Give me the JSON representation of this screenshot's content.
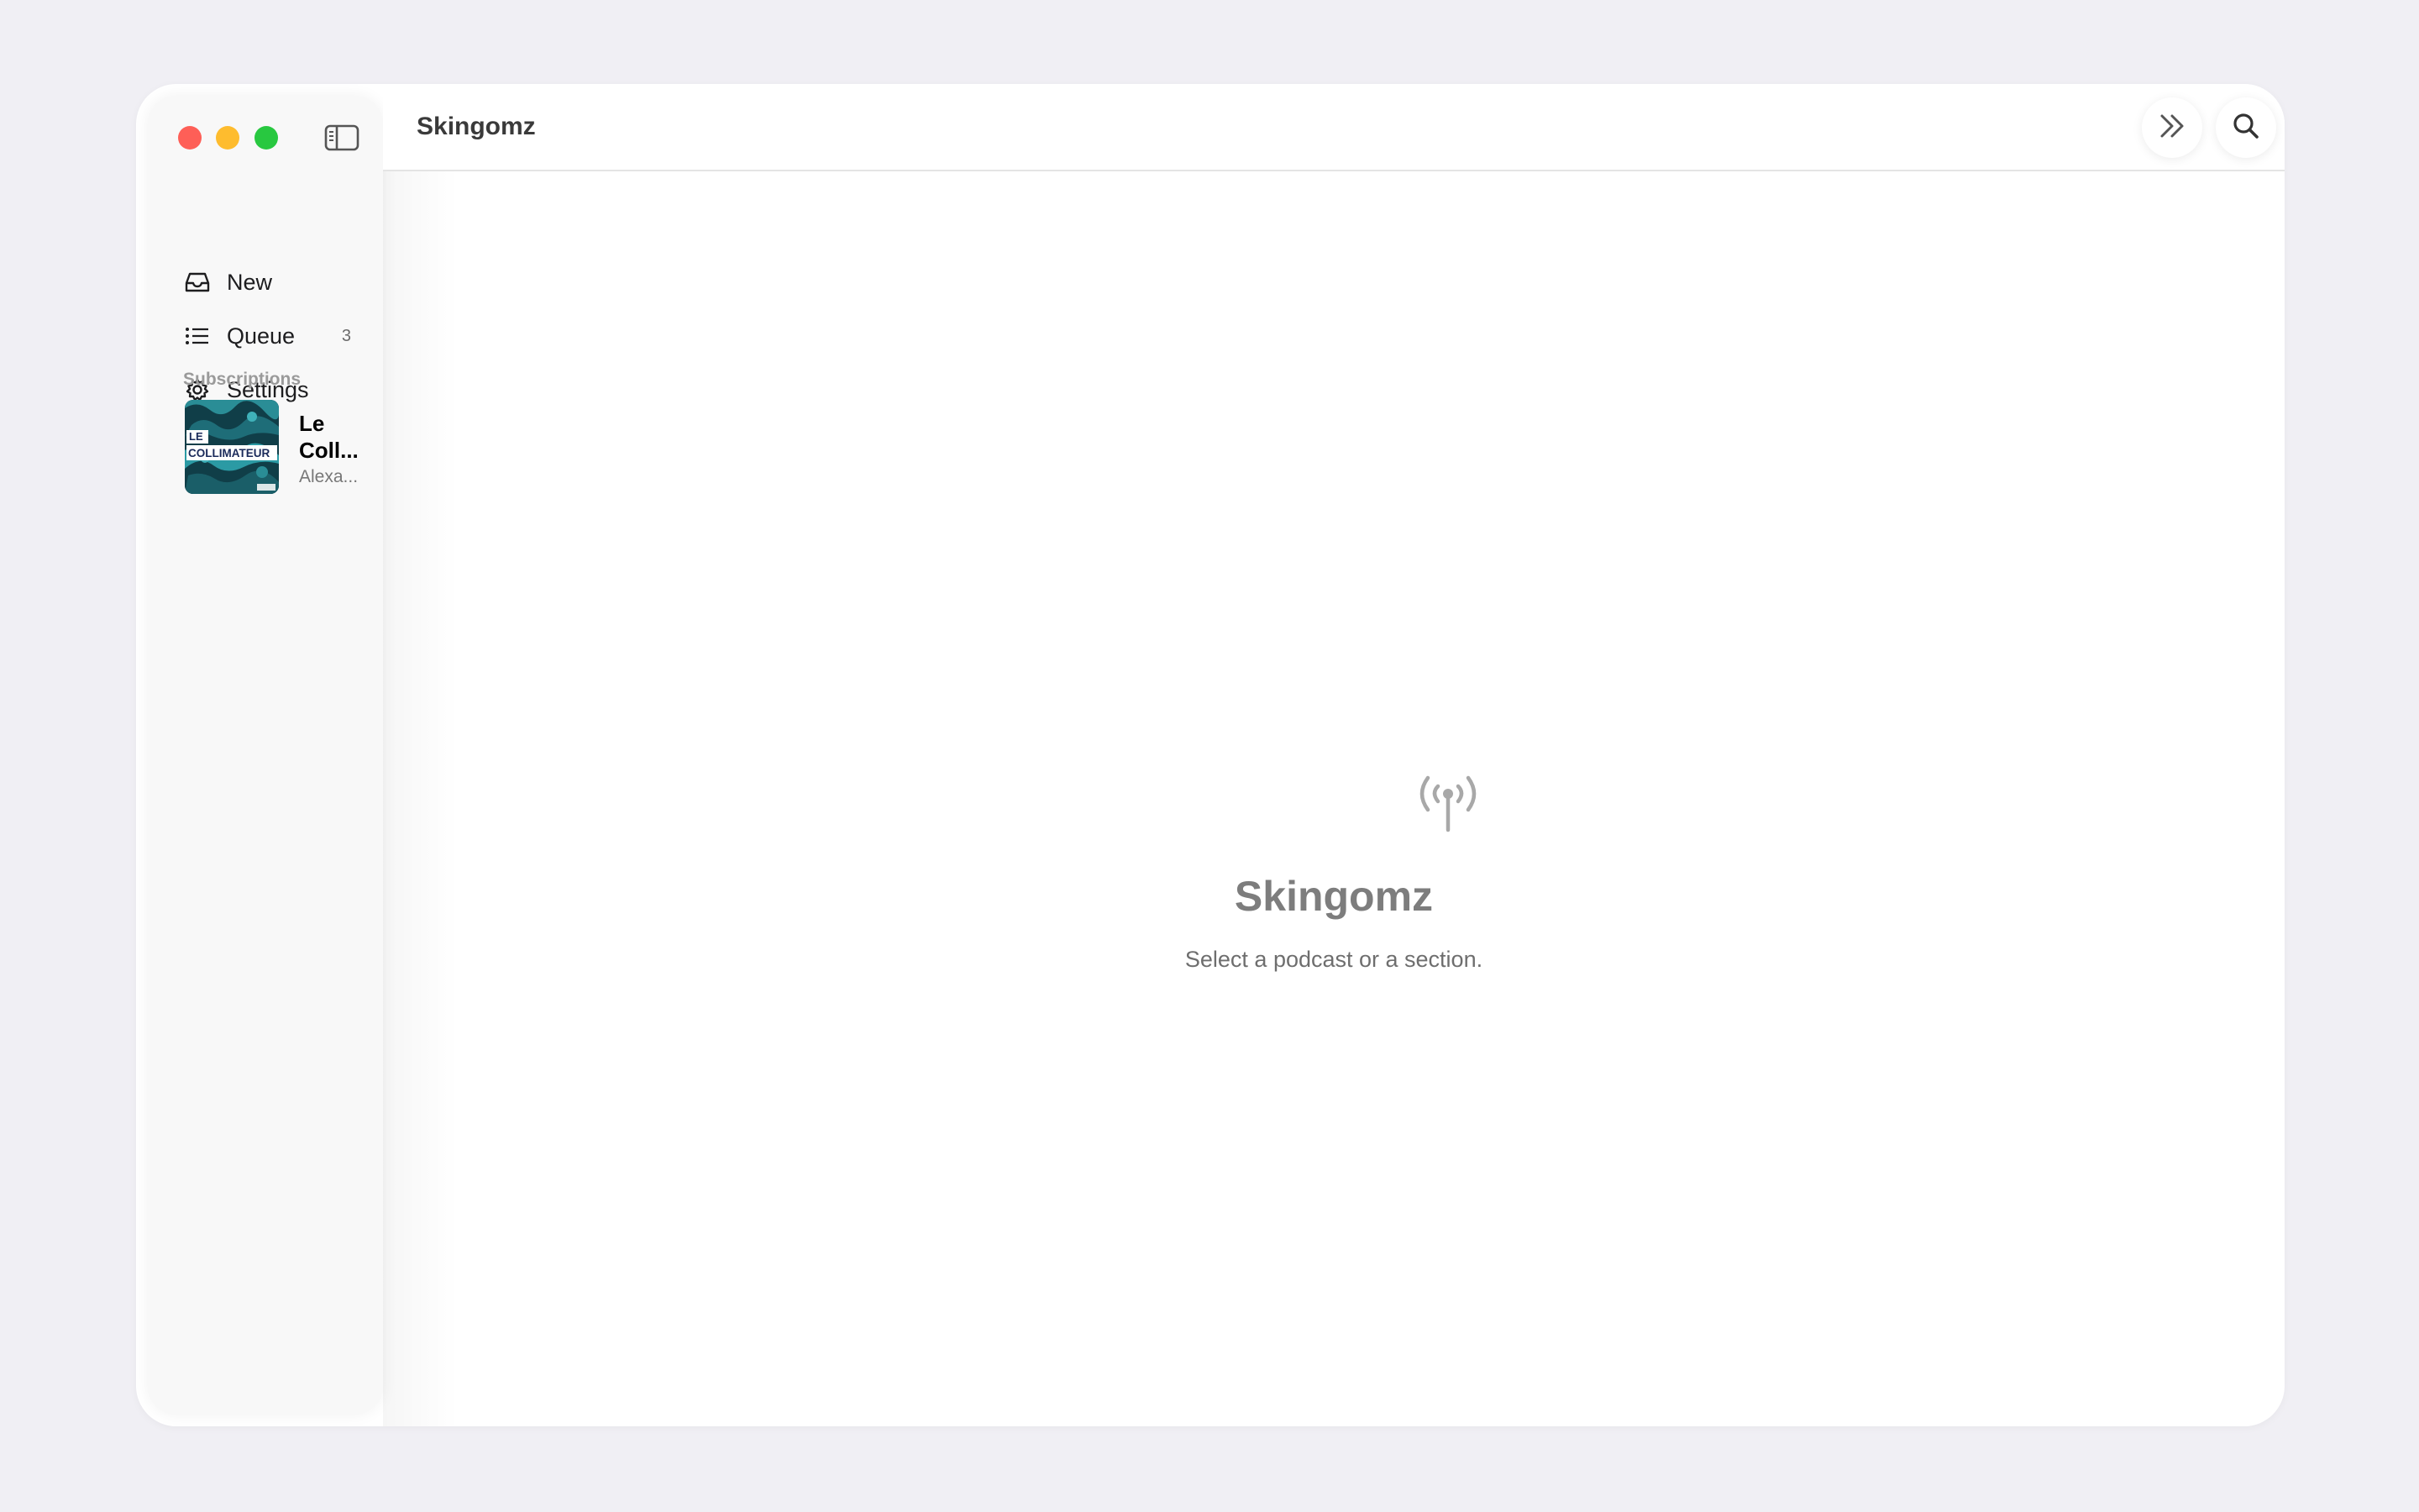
{
  "window": {
    "title": "Skingomz",
    "controls": [
      "close",
      "minimize",
      "zoom"
    ],
    "colors": {
      "close": "#fe5f57",
      "minimize": "#febc2e",
      "zoom": "#28c840"
    }
  },
  "sidebar": {
    "toggle_icon": "sidebar-toggle-icon",
    "items": [
      {
        "label": "New",
        "icon": "tray-icon"
      },
      {
        "label": "Queue",
        "icon": "list-icon",
        "count": "3"
      },
      {
        "label": "Settings",
        "icon": "gear-icon"
      }
    ],
    "subscriptions_header": "Subscriptions",
    "subscriptions": [
      {
        "title": "Le Coll...",
        "author": "Alexa...",
        "artwork_text_1": "LE",
        "artwork_text_2": "COLLIMATEUR"
      }
    ]
  },
  "toolbar": {
    "title": "Skingomz",
    "buttons": [
      {
        "icon": "chevron-double-right-icon"
      },
      {
        "icon": "search-icon"
      }
    ]
  },
  "empty_state": {
    "icon": "antenna-radiowaves-icon",
    "title": "Skingomz",
    "subtitle": "Select a podcast or a section."
  }
}
